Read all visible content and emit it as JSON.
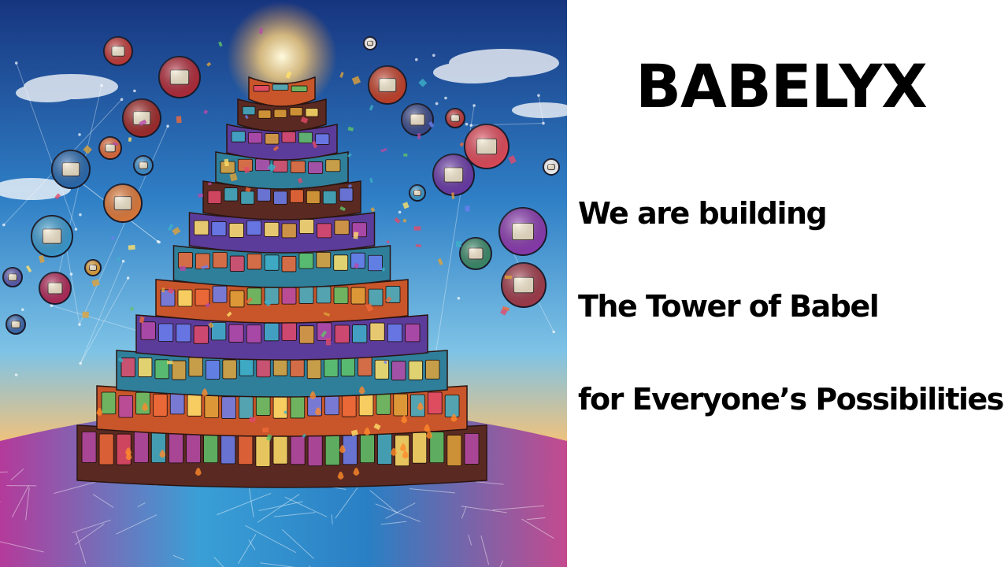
{
  "slide": {
    "title": "BABELYX",
    "lines": [
      "We are building",
      "The Tower of Babel",
      "for Everyone’s Possibilities"
    ]
  },
  "artwork": {
    "subject": "tower-of-babel-illustration",
    "colors": {
      "sky_top": "#1b3f8f",
      "sky_mid": "#3a8fd0",
      "horizon": "#f2c27a",
      "ground_pink": "#d9468f",
      "ground_blue": "#2a7fc4",
      "tower_dark": "#5a2a22",
      "tower_orange": "#c8562a",
      "tower_purple": "#5b3c9a",
      "tower_teal": "#2f7f9a",
      "glow": "#fff4b0"
    }
  }
}
